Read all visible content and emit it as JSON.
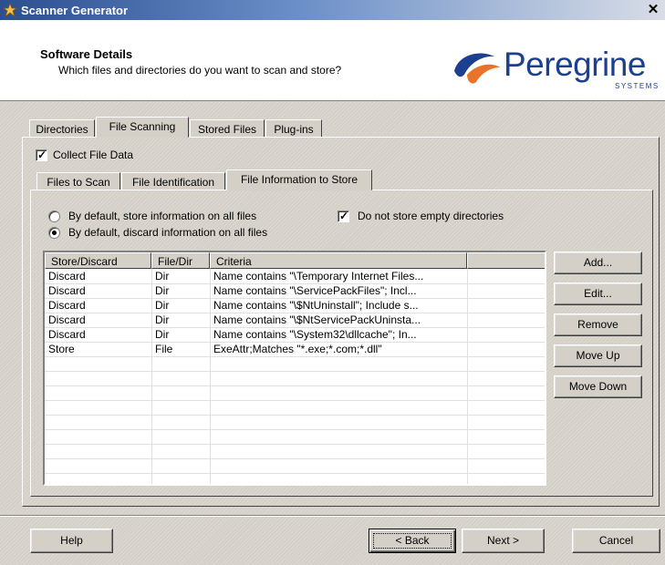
{
  "window": {
    "title": "Scanner Generator",
    "close_glyph": "✕"
  },
  "header": {
    "title": "Software Details",
    "subtitle": "Which files and directories do you want to scan and store?",
    "logo_text": "Peregrine",
    "logo_sub": "SYSTEMS"
  },
  "main_tabs": [
    "Directories",
    "File Scanning",
    "Stored Files",
    "Plug-ins"
  ],
  "active_main_tab": "File Scanning",
  "collect_file_data": {
    "label": "Collect File Data",
    "checked": true
  },
  "sub_tabs": [
    "Files to Scan",
    "File Identification",
    "File Information to Store"
  ],
  "active_sub_tab": "File Information to Store",
  "options": {
    "radio_store": "By default, store information on all files",
    "radio_discard": "By default, discard information on all files",
    "selected": "discard",
    "empty_dirs_label": "Do not store empty directories",
    "empty_dirs_checked": true
  },
  "table": {
    "columns": [
      "Store/Discard",
      "File/Dir",
      "Criteria",
      ""
    ],
    "rows": [
      [
        "Discard",
        "Dir",
        "Name contains \"\\Temporary Internet Files...",
        ""
      ],
      [
        "Discard",
        "Dir",
        "Name contains \"\\ServicePackFiles\"; Incl...",
        ""
      ],
      [
        "Discard",
        "Dir",
        "Name contains \"\\$NtUninstall\"; Include s...",
        ""
      ],
      [
        "Discard",
        "Dir",
        "Name contains \"\\$NtServicePackUninsta...",
        ""
      ],
      [
        "Discard",
        "Dir",
        "Name contains \"\\System32\\dllcache\"; In...",
        ""
      ],
      [
        "Store",
        "File",
        "ExeAttr;Matches \"*.exe;*.com;*.dll\"",
        ""
      ]
    ]
  },
  "side_buttons": {
    "add": "Add...",
    "edit": "Edit...",
    "remove": "Remove",
    "move_up": "Move Up",
    "move_down": "Move Down"
  },
  "footer": {
    "help": "Help",
    "back": "< Back",
    "next": "Next >",
    "cancel": "Cancel"
  },
  "colors": {
    "accent": "#0a246a",
    "logo": "#1d3f8f",
    "face": "#d4d0c8"
  },
  "icons": {
    "app": "scanner-wizard-icon",
    "logo": "peregrine-bird-icon"
  }
}
